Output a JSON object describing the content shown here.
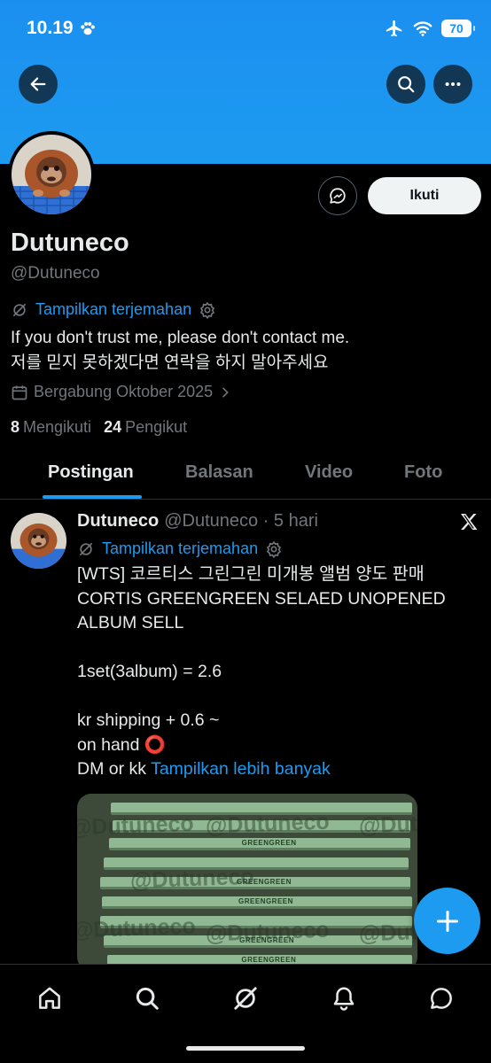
{
  "status_bar": {
    "time": "10.19",
    "battery": "70"
  },
  "profile": {
    "name": "Dutuneco",
    "handle": "@Dutuneco",
    "follow_label": "Ikuti",
    "translate_label": "Tampilkan terjemahan",
    "bio_line1": "If you don't trust me, please don't contact me.",
    "bio_line2": "저를 믿지 못하겠다면 연락을 하지 말아주세요",
    "joined": "Bergabung Oktober 2025",
    "following_count": "8",
    "following_label": "Mengikuti",
    "followers_count": "24",
    "followers_label": "Pengikut"
  },
  "tabs": [
    {
      "label": "Postingan"
    },
    {
      "label": "Balasan"
    },
    {
      "label": "Video"
    },
    {
      "label": "Foto"
    }
  ],
  "post": {
    "author": "Dutuneco",
    "meta": "@Dutuneco · 5 hari",
    "translate_label": "Tampilkan terjemahan",
    "line1": "[WTS] 코르티스 그린그린 미개봉 앨범 양도 판매",
    "line2": "CORTIS GREENGREEN SELAED UNOPENED",
    "line3": "ALBUM SELL",
    "line4": "1set(3album) = 2.6",
    "line5": "kr shipping + 0.6 ~",
    "line6": "on hand ⭕",
    "line7": "DM or kk",
    "more_label": "Tampilkan lebih banyak",
    "media_watermark": "@Dutuneco",
    "album_label": "GREENGREEN"
  },
  "colors": {
    "accent": "#1d9bf0",
    "banner": "#1d9bf0",
    "background": "#000000"
  },
  "icons": [
    "back-arrow-icon",
    "search-icon",
    "more-icon",
    "message-icon",
    "translate-icon",
    "gear-icon",
    "calendar-icon",
    "chevron-right-icon",
    "x-logo-icon",
    "plus-icon",
    "home-icon",
    "grok-icon",
    "bell-icon",
    "chat-icon"
  ]
}
